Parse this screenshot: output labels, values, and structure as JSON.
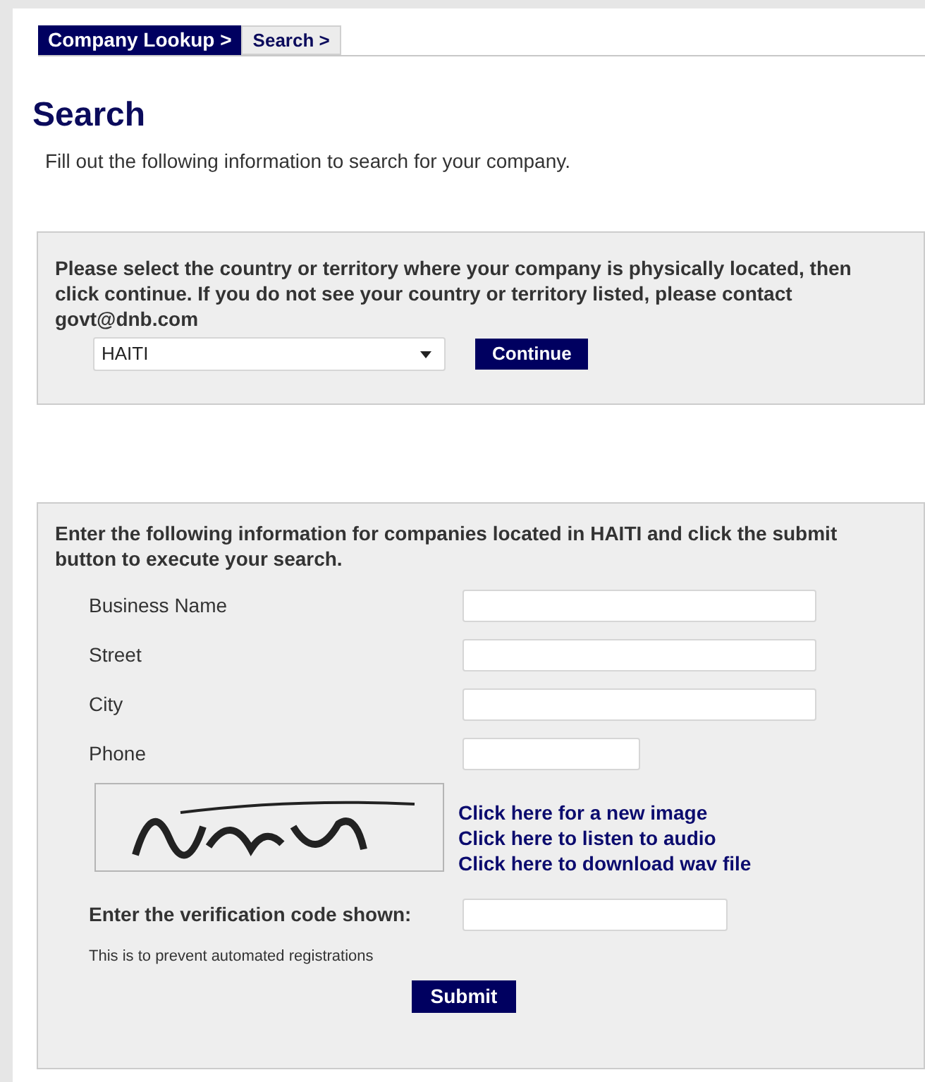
{
  "breadcrumb": [
    {
      "label": "Company Lookup >",
      "selected": true
    },
    {
      "label": "Search >",
      "selected": false
    }
  ],
  "heading": "Search",
  "intro": "Fill out the following information to search for your company.",
  "country_panel": {
    "instructions": "Please select the country or territory where your company is physically located, then click continue. If you do not see your country or territory listed, please contact govt@dnb.com",
    "country": "HAITI",
    "button": "Continue"
  },
  "search_panel": {
    "instructions": "Enter the following information for companies located in HAITI and click the submit button to execute your search.",
    "fields": [
      {
        "label": "Business Name",
        "kind": "wide"
      },
      {
        "label": "Street",
        "kind": "wide"
      },
      {
        "label": "City",
        "kind": "wide"
      },
      {
        "label": "Phone",
        "kind": "narrow"
      }
    ],
    "captcha": {
      "links": [
        "Click here for a new image",
        "Click here to listen to audio",
        "Click here to download wav file"
      ]
    },
    "verification_label": "Enter the verification code shown:",
    "note": "This is to prevent automated registrations",
    "button": "Submit"
  }
}
